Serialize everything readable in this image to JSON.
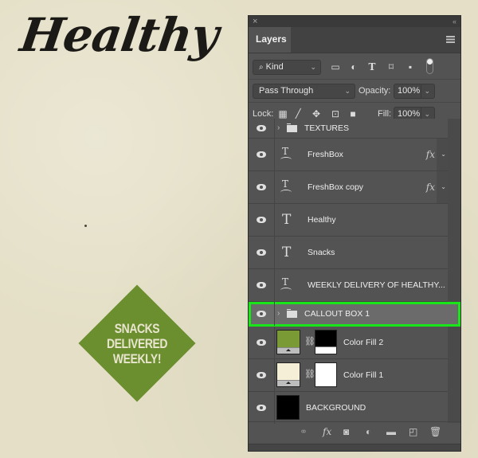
{
  "canvas": {
    "title_text": "Healthy",
    "callout_lines": [
      "SNACKS",
      "DELIVERED",
      "WEEKLY!"
    ],
    "callout_color": "#6b8f2e",
    "background_color": "#e4dfc6"
  },
  "panel": {
    "close_glyph": "×",
    "collapse_glyph": "‹‹",
    "tab_label": "Layers",
    "filter": {
      "label": "Kind",
      "icons": [
        "image-filter-icon",
        "adjustment-filter-icon",
        "type-filter-icon",
        "shape-filter-icon",
        "smart-object-filter-icon",
        "filter-toggle-icon"
      ]
    },
    "blend_mode": "Pass Through",
    "opacity_label": "Opacity:",
    "opacity_value": "100%",
    "lock_label": "Lock:",
    "fill_label": "Fill:",
    "fill_value": "100%",
    "layers": [
      {
        "name": "TEXTURES",
        "kind": "group",
        "visible": true
      },
      {
        "name": "FreshBox",
        "kind": "warped-text",
        "visible": true,
        "fx": "fx"
      },
      {
        "name": "FreshBox copy",
        "kind": "warped-text",
        "visible": true,
        "fx": "fx"
      },
      {
        "name": "Healthy",
        "kind": "text",
        "visible": true
      },
      {
        "name": "Snacks",
        "kind": "text",
        "visible": true
      },
      {
        "name": "WEEKLY DELIVERY OF HEALTHY...",
        "kind": "warped-text",
        "visible": true
      },
      {
        "name": "CALLOUT BOX 1",
        "kind": "group",
        "visible": true,
        "selected": true
      },
      {
        "name": "Color Fill 2",
        "kind": "fill",
        "visible": true,
        "fill_color": "#7a9a35"
      },
      {
        "name": "Color Fill 1",
        "kind": "fill",
        "visible": true,
        "fill_color": "#f4efd6"
      },
      {
        "name": "BACKGROUND",
        "kind": "fill-black",
        "visible": true
      }
    ],
    "highlight_color": "#19e619",
    "type_glyph": "T",
    "fx_glyph": "fx"
  }
}
